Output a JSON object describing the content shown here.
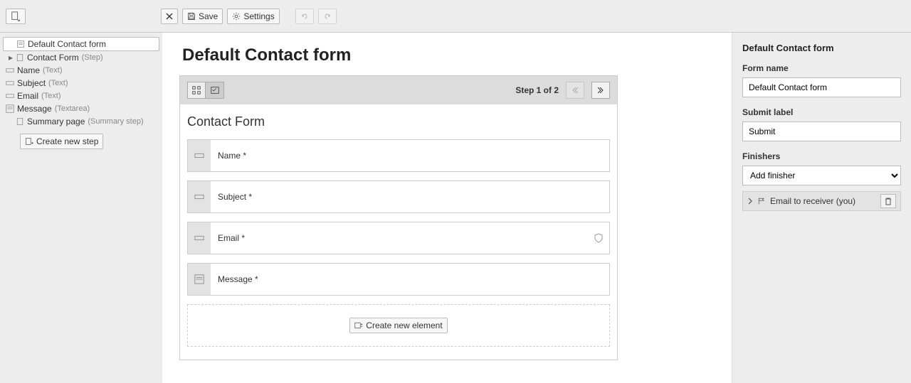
{
  "toolbar": {
    "save_label": "Save",
    "settings_label": "Settings"
  },
  "tree": {
    "root_label": "Default Contact form",
    "items": [
      {
        "label": "Contact Form",
        "type": "(Step)"
      },
      {
        "label": "Name",
        "type": "(Text)"
      },
      {
        "label": "Subject",
        "type": "(Text)"
      },
      {
        "label": "Email",
        "type": "(Text)"
      },
      {
        "label": "Message",
        "type": "(Textarea)"
      },
      {
        "label": "Summary page",
        "type": "(Summary step)"
      }
    ],
    "create_step_label": "Create new step"
  },
  "main": {
    "title": "Default Contact form",
    "step_indicator": "Step 1 of 2",
    "step_title": "Contact Form",
    "fields": [
      {
        "label": "Name *"
      },
      {
        "label": "Subject *"
      },
      {
        "label": "Email *"
      },
      {
        "label": "Message *"
      }
    ],
    "create_element_label": "Create new element"
  },
  "panel": {
    "title": "Default Contact form",
    "form_name_label": "Form name",
    "form_name_value": "Default Contact form",
    "submit_label_label": "Submit label",
    "submit_label_value": "Submit",
    "finishers_label": "Finishers",
    "add_finisher_option": "Add finisher",
    "finisher_item_label": "Email to receiver (you)"
  }
}
